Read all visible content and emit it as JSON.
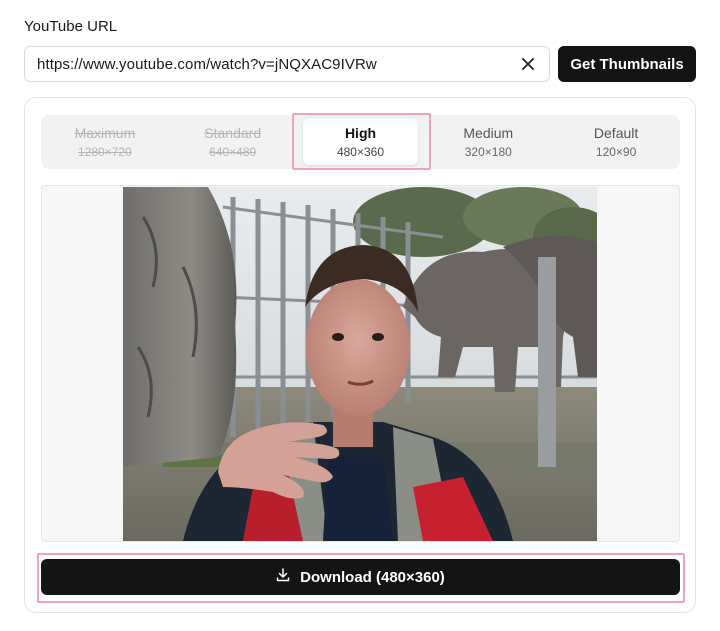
{
  "form": {
    "url_label": "YouTube URL",
    "url_value": "https://www.youtube.com/watch?v=jNQXAC9IVRw",
    "get_button": "Get Thumbnails",
    "clear_icon": "close-icon"
  },
  "tabs": [
    {
      "name": "Maximum",
      "res": "1280×720",
      "state": "disabled"
    },
    {
      "name": "Standard",
      "res": "640×480",
      "state": "disabled"
    },
    {
      "name": "High",
      "res": "480×360",
      "state": "active"
    },
    {
      "name": "Medium",
      "res": "320×180",
      "state": "normal"
    },
    {
      "name": "Default",
      "res": "120×90",
      "state": "normal"
    }
  ],
  "download": {
    "label": "Download (480×360)",
    "icon": "download-icon"
  },
  "colors": {
    "primary": "#141414",
    "highlight": "#f0a3b8",
    "tab_bg": "#f2f2f2"
  }
}
